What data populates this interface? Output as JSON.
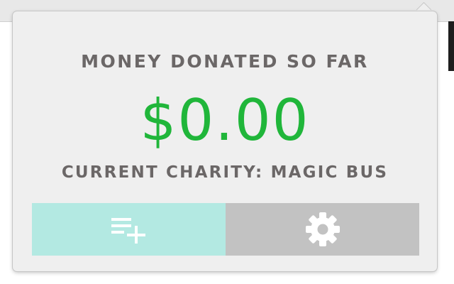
{
  "popup": {
    "title": "MONEY DONATED SO FAR",
    "amount": "$0.00",
    "charity_line": "CURRENT CHARITY: MAGIC BUS"
  },
  "buttons": [
    {
      "icon": "playlist-add-icon",
      "color": "#b3e9e2"
    },
    {
      "icon": "gear-icon",
      "color": "#c2c2c2"
    }
  ],
  "colors": {
    "amount": "#20b63a",
    "label": "#6b6767",
    "panel": "#efefef"
  }
}
